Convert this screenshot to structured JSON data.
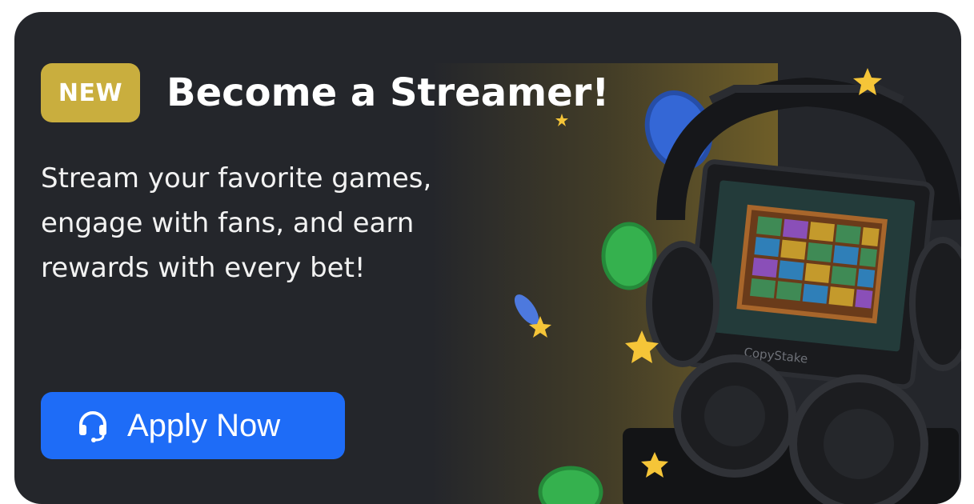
{
  "banner": {
    "badge": "NEW",
    "title": "Become a Streamer!",
    "description": "Stream your favorite games, engage with fans, and earn rewards with every bet!",
    "cta_label": "Apply Now",
    "cta_icon": "headset-icon",
    "illustration_label": "CopyStake"
  },
  "colors": {
    "background": "#24262b",
    "badge": "#c9ae3e",
    "cta": "#1e6cf7",
    "glow": "#7c6828"
  }
}
